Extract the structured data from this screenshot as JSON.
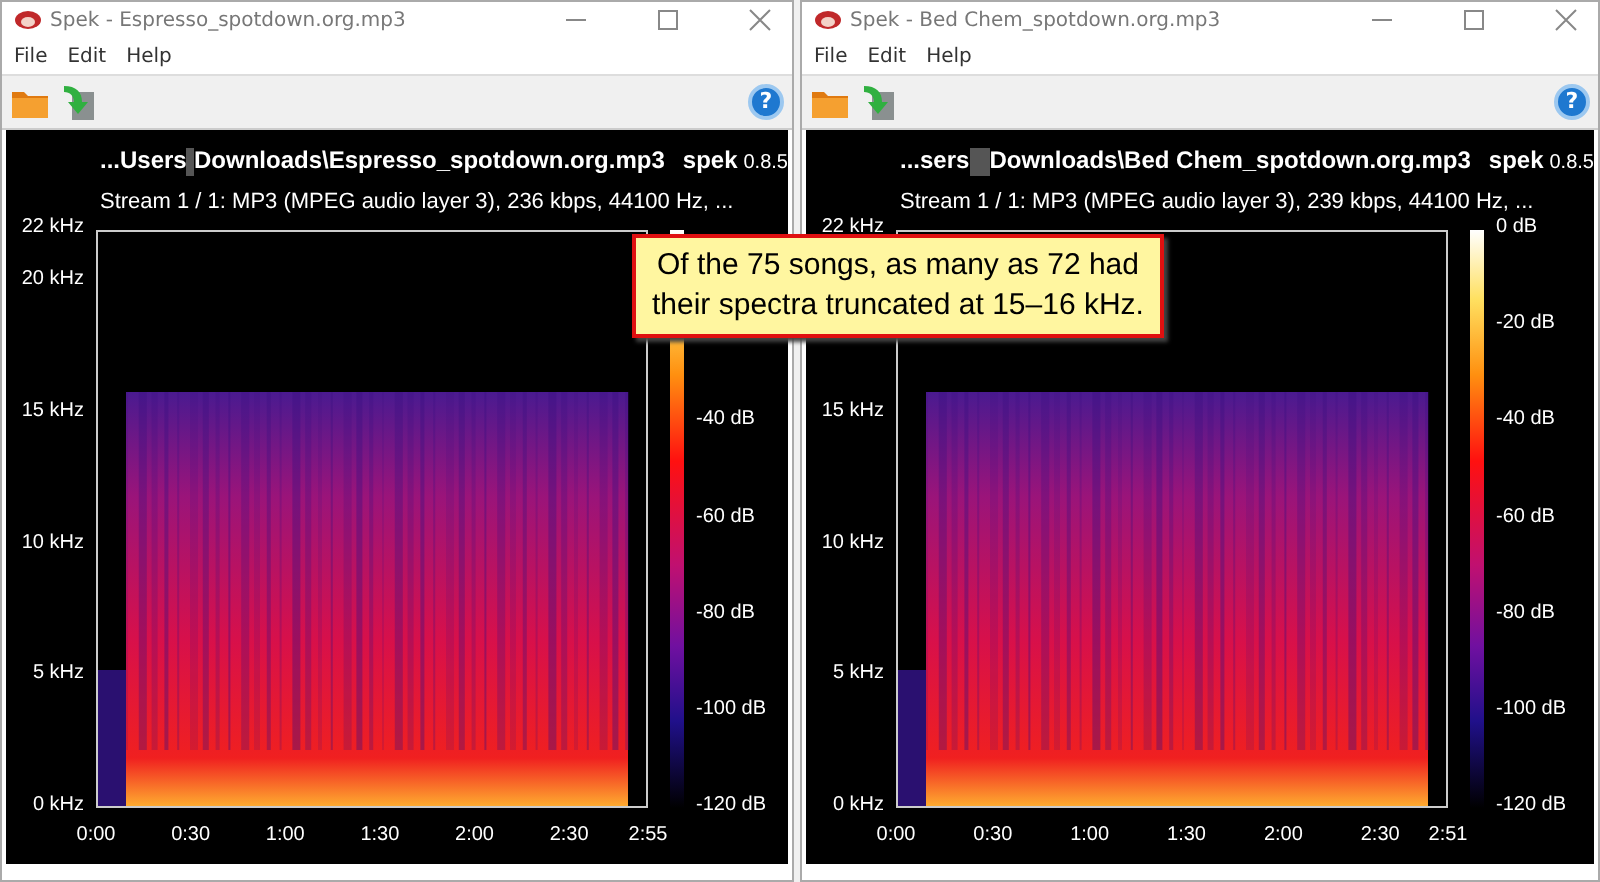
{
  "windows": [
    {
      "title": "Spek - Espresso_spotdown.org.mp3",
      "menu": [
        "File",
        "Edit",
        "Help"
      ],
      "help_glyph": "?",
      "path_start": "...Users",
      "path_end": "Downloads\\Espresso_spotdown.org.mp3",
      "app_name": "spek",
      "version": "0.8.5",
      "stream_info": "Stream 1 / 1: MP3 (MPEG audio layer 3), 236 kbps, 44100 Hz, ...",
      "freq_labels": [
        "22 kHz",
        "20 kHz",
        "15 kHz",
        "10 kHz",
        "5 kHz",
        "0 kHz"
      ],
      "time_labels": [
        "0:00",
        "0:30",
        "1:00",
        "1:30",
        "2:00",
        "2:30",
        "2:55"
      ],
      "db_labels": [
        "-40 dB",
        "-60 dB",
        "-80 dB",
        "-100 dB",
        "-120 dB"
      ]
    },
    {
      "title": "Spek - Bed Chem_spotdown.org.mp3",
      "menu": [
        "File",
        "Edit",
        "Help"
      ],
      "help_glyph": "?",
      "path_start": "...sers",
      "path_end": "Downloads\\Bed Chem_spotdown.org.mp3",
      "app_name": "spek",
      "version": "0.8.5",
      "stream_info": "Stream 1 / 1: MP3 (MPEG audio layer 3), 239 kbps, 44100 Hz, ...",
      "freq_labels": [
        "22 kHz",
        "15 kHz",
        "10 kHz",
        "5 kHz",
        "0 kHz"
      ],
      "time_labels": [
        "0:00",
        "0:30",
        "1:00",
        "1:30",
        "2:00",
        "2:30",
        "2:51"
      ],
      "db_labels": [
        "0 dB",
        "-20 dB",
        "-40 dB",
        "-60 dB",
        "-80 dB",
        "-100 dB",
        "-120 dB"
      ]
    }
  ],
  "callout": "Of the 75 songs, as many as 72 had\ntheir spectra truncated at 15–16 kHz."
}
